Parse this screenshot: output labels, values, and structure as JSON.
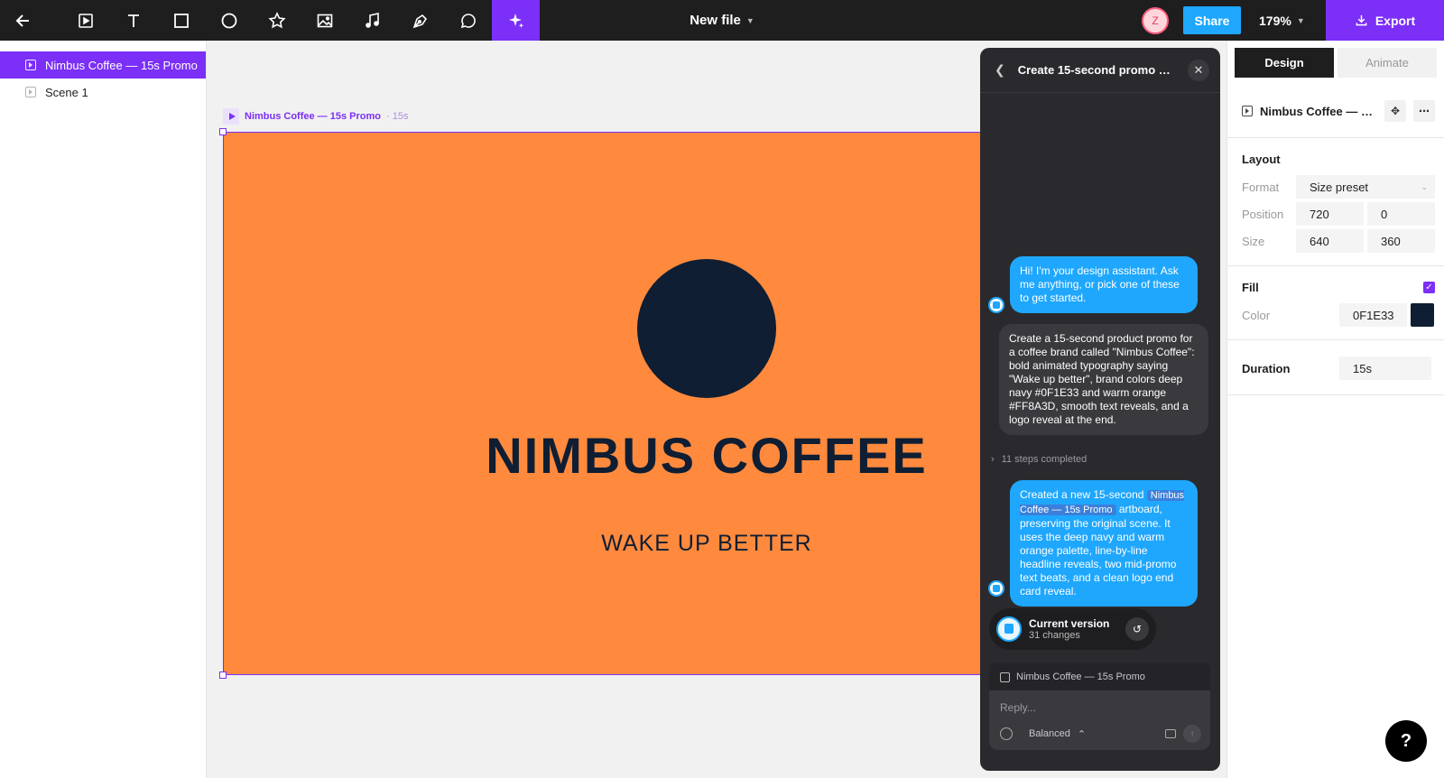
{
  "toolbar": {
    "tools": [
      "back-arrow-icon",
      "scene-icon",
      "text-icon",
      "rectangle-icon",
      "ellipse-icon",
      "star-icon",
      "image-icon",
      "music-icon",
      "pen-icon",
      "comment-icon",
      "ai-sparkle-icon"
    ],
    "file_title": "New file",
    "avatar_initial": "Z",
    "share_label": "Share",
    "zoom": "179%",
    "export_label": "Export"
  },
  "layers": {
    "items": [
      {
        "label": "Nimbus Coffee — 15s Promo",
        "selected": true
      },
      {
        "label": "Scene 1",
        "selected": false
      }
    ]
  },
  "canvas": {
    "artboard_label": "Nimbus Coffee — 15s Promo",
    "artboard_duration": "· 15s",
    "brand_title": "NIMBUS COFFEE",
    "tagline": "WAKE UP BETTER",
    "colors": {
      "background": "#FF8A3D",
      "navy": "#0F1E33",
      "accent": "#7B2FF7"
    }
  },
  "assistant": {
    "title": "Create 15-second promo vi...",
    "greeting": "Hi! I'm your design assistant. Ask me anything, or pick one of these to get started.",
    "user_prompt": "Create a 15-second product promo for a coffee brand called \"Nimbus Coffee\": bold animated typography saying \"Wake up better\", brand colors deep navy #0F1E33 and warm orange #FF8A3D, smooth text reveals, and a logo reveal at the end.",
    "steps": "11 steps completed",
    "response_pre": "Created a new 15-second",
    "response_chip": "Nimbus Coffee — 15s Promo",
    "response_post": "artboard, preserving the original scene. It uses the deep navy and warm orange palette, line-by-line headline reveals, two mid-promo text beats, and a clean logo end card reveal.",
    "version_title": "Current version",
    "version_changes": "31 changes",
    "context_label": "Nimbus Coffee — 15s Promo",
    "reply_placeholder": "Reply...",
    "mode": "Balanced"
  },
  "inspector": {
    "tab_design": "Design",
    "tab_animate": "Animate",
    "layer_name": "Nimbus Coffee — 1...",
    "layout_title": "Layout",
    "format_label": "Format",
    "format_value": "Size preset",
    "position_label": "Position",
    "position_x": "720",
    "position_y": "0",
    "size_label": "Size",
    "size_w": "640",
    "size_h": "360",
    "fill_title": "Fill",
    "color_label": "Color",
    "color_value": "0F1E33",
    "duration_title": "Duration",
    "duration_value": "15s"
  },
  "help_label": "?"
}
